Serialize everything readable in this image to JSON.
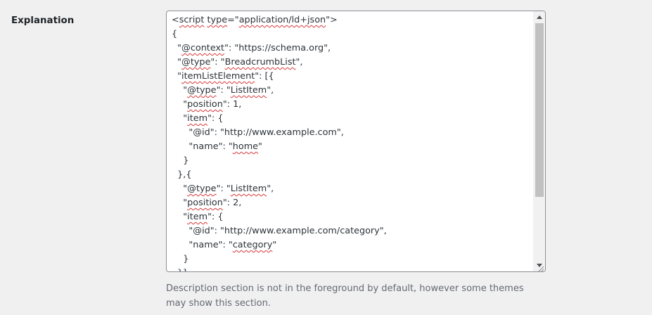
{
  "field": {
    "label": "Explanation"
  },
  "code_lines": [
    [
      {
        "t": "<"
      },
      {
        "t": "script",
        "s": true
      },
      {
        "t": " "
      },
      {
        "t": "type",
        "s": true
      },
      {
        "t": "=\""
      },
      {
        "t": "application/ld+json",
        "s": true
      },
      {
        "t": "\">"
      }
    ],
    [
      {
        "t": "{"
      }
    ],
    [
      {
        "t": "  \""
      },
      {
        "t": "@context",
        "s": true
      },
      {
        "t": "\": \"https://schema.org\","
      }
    ],
    [
      {
        "t": "  \""
      },
      {
        "t": "@type",
        "s": true
      },
      {
        "t": "\": \""
      },
      {
        "t": "BreadcrumbList",
        "s": true
      },
      {
        "t": "\","
      }
    ],
    [
      {
        "t": "  \""
      },
      {
        "t": "itemListElement",
        "s": true
      },
      {
        "t": "\": [{"
      }
    ],
    [
      {
        "t": "    \""
      },
      {
        "t": "@type",
        "s": true
      },
      {
        "t": "\": \""
      },
      {
        "t": "ListItem",
        "s": true
      },
      {
        "t": "\","
      }
    ],
    [
      {
        "t": "    \""
      },
      {
        "t": "position",
        "s": true
      },
      {
        "t": "\": 1,"
      }
    ],
    [
      {
        "t": "    \""
      },
      {
        "t": "item",
        "s": true
      },
      {
        "t": "\": {"
      }
    ],
    [
      {
        "t": "      \"@id\": \"http://www.example.com\","
      }
    ],
    [
      {
        "t": "      \"name\": \""
      },
      {
        "t": "home",
        "s": true
      },
      {
        "t": "\""
      }
    ],
    [
      {
        "t": "    }"
      }
    ],
    [
      {
        "t": "  },{"
      }
    ],
    [
      {
        "t": "    \""
      },
      {
        "t": "@type",
        "s": true
      },
      {
        "t": "\": \""
      },
      {
        "t": "ListItem",
        "s": true
      },
      {
        "t": "\","
      }
    ],
    [
      {
        "t": "    \""
      },
      {
        "t": "position",
        "s": true
      },
      {
        "t": "\": 2,"
      }
    ],
    [
      {
        "t": "    \""
      },
      {
        "t": "item",
        "s": true
      },
      {
        "t": "\": {"
      }
    ],
    [
      {
        "t": "      \"@id\": \"http://www.example.com/category\","
      }
    ],
    [
      {
        "t": "      \"name\": \""
      },
      {
        "t": "category",
        "s": true
      },
      {
        "t": "\""
      }
    ],
    [
      {
        "t": "    }"
      }
    ],
    [
      {
        "t": "  }]"
      }
    ]
  ],
  "description": "Description section is not in the foreground by default, however some themes may show this section.",
  "icons": {
    "scroll_up": "scroll-up-arrow-icon",
    "scroll_down": "scroll-down-arrow-icon",
    "resize": "resize-grip-icon"
  },
  "colors": {
    "background": "#f0f0f1",
    "text": "#1d2327",
    "description": "#646970",
    "spellcheck": "#d63638",
    "scroll_thumb": "#c1c1c1"
  }
}
